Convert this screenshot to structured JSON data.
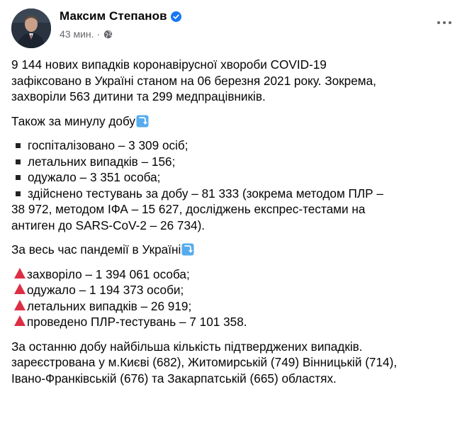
{
  "author": {
    "name": "Максим Степанов",
    "time": "43 мин.",
    "dot": "·"
  },
  "post": {
    "intro": [
      "9 144 нових випадків коронавірусної хвороби COVID-19",
      "зафіксовано в Україні станом на 06 березня 2021 року. Зокрема,",
      "захворіли 563 дитини та 299 медпрацівників."
    ],
    "daily_heading": "Також за минулу добу",
    "daily_items": [
      [
        "госпіталізовано – 3 309 осіб;"
      ],
      [
        "летальних випадків – 156;"
      ],
      [
        "одужало – 3 351 особа;"
      ],
      [
        "здійснено тестувань за добу – 81 333 (зокрема методом ПЛР –",
        "38 972, методом ІФА – 15 627, досліджень експрес-тестами на",
        "антиген до SARS-CoV-2 – 26 734)."
      ]
    ],
    "total_heading": "За весь час пандемії в Україні",
    "total_items": [
      "захворіло – 1 394 061 особа;",
      "одужало – 1 194 373 особи;",
      "летальних випадків – 26 919;",
      "проведено ПЛР-тестувань – 7 101 358."
    ],
    "regions": [
      "За останню добу найбільша кількість підтверджених випадків.",
      "зареєстрована у м.Києві (682), Житомирській (749) Вінницькій (714),",
      "Івано-Франківській (676) та Закарпатській (665) областях."
    ]
  },
  "colors": {
    "verified": "#1877f2",
    "triangle": "#dd2e44",
    "arrow_emoji": "#55acee"
  },
  "icons": [
    "verified-badge-icon",
    "globe-icon",
    "more-options-icon",
    "arrow-down-emoji-icon",
    "red-triangle-icon",
    "square-bullet-icon"
  ]
}
